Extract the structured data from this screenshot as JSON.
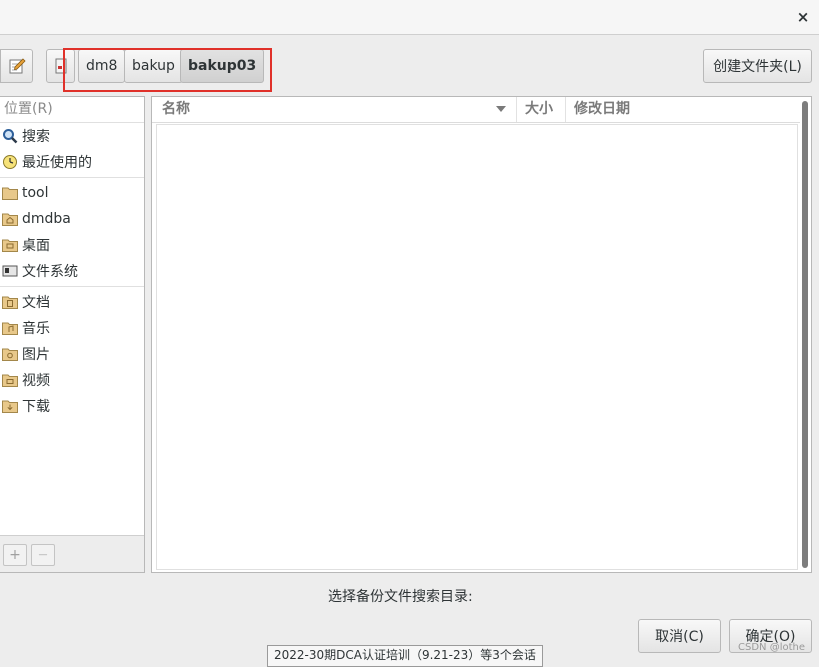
{
  "window": {
    "close_symbol": "×"
  },
  "toolbar": {
    "breadcrumbs": [
      "dm8",
      "bakup",
      "bakup03"
    ],
    "new_folder_label": "创建文件夹(L)"
  },
  "sidebar": {
    "header": "位置(R)",
    "items": [
      {
        "label": "搜索",
        "icon": "search-icon"
      },
      {
        "label": "最近使用的",
        "icon": "recent-clock-icon"
      },
      {
        "label": "tool",
        "icon": "folder-icon"
      },
      {
        "label": "dmdba",
        "icon": "home-folder-icon"
      },
      {
        "label": "桌面",
        "icon": "desktop-folder-icon"
      },
      {
        "label": "文件系统",
        "icon": "drive-icon"
      },
      {
        "label": "文档",
        "icon": "documents-folder-icon"
      },
      {
        "label": "音乐",
        "icon": "music-folder-icon"
      },
      {
        "label": "图片",
        "icon": "pictures-folder-icon"
      },
      {
        "label": "视频",
        "icon": "videos-folder-icon"
      },
      {
        "label": "下载",
        "icon": "downloads-folder-icon"
      }
    ],
    "add_label": "+",
    "remove_label": "—"
  },
  "filelist": {
    "columns": {
      "name": "名称",
      "size": "大小",
      "modified": "修改日期"
    }
  },
  "footer": {
    "search_label": "选择备份文件搜索目录:",
    "cancel_label": "取消(C)",
    "ok_label": "确定(O)"
  },
  "taskbar_tooltip": "2022-30期DCA认证培训（9.21-23）等3个会话",
  "watermark": "CSDN @lothe",
  "colors": {
    "highlight": "#e0312a",
    "folder": "#e8c88a"
  }
}
